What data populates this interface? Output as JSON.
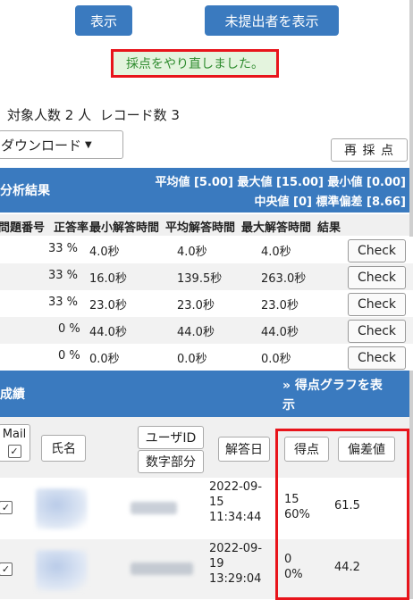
{
  "buttons": {
    "show": "表示",
    "show_unsubmitted": "未提出者を表示",
    "download": "ダウンロード",
    "rescore": "再 採 点"
  },
  "message": "採点をやり直しました。",
  "counts": "対象人数 2 人  レコード数 3",
  "analysis": {
    "title": "分析結果",
    "stats_line1": "平均値 [5.00] 最大値 [15.00] 最小値 [0.00]",
    "stats_line2": "中央値 [0] 標準偏差 [8.66]"
  },
  "question_table": {
    "headers": [
      "問題番号",
      "正答率",
      "最小解答時間",
      "平均解答時間",
      "最大解答時間",
      "結果"
    ],
    "check_label": "Check",
    "rows": [
      {
        "rate": "33 %",
        "min": "4.0秒",
        "avg": "4.0秒",
        "max": "4.0秒"
      },
      {
        "rate": "33 %",
        "min": "16.0秒",
        "avg": "139.5秒",
        "max": "263.0秒"
      },
      {
        "rate": "33 %",
        "min": "23.0秒",
        "avg": "23.0秒",
        "max": "23.0秒"
      },
      {
        "rate": "0 %",
        "min": "44.0秒",
        "avg": "44.0秒",
        "max": "44.0秒"
      },
      {
        "rate": "0 %",
        "min": "0.0秒",
        "avg": "0.0秒",
        "max": "0.0秒"
      }
    ]
  },
  "results": {
    "title": "成績",
    "graph_link": "» 得点グラフを表示",
    "graph_link_line1": "» 得点グラフを表",
    "graph_link_line2": "示",
    "headers": {
      "mail": "Mail",
      "name": "氏名",
      "userid": "ユーザID",
      "digits": "数字部分",
      "date": "解答日",
      "score": "得点",
      "deviation": "偏差値"
    },
    "rows": [
      {
        "date_l1": "2022-09-",
        "date_l2": "15",
        "date_l3": "11:34:44",
        "score": "15",
        "percent": "60%",
        "deviation": "61.5"
      },
      {
        "date_l1": "2022-09-",
        "date_l2": "19",
        "date_l3": "13:29:04",
        "score": "0",
        "percent": "0%",
        "deviation": "44.2"
      }
    ]
  },
  "colors": {
    "accent": "#3a7abf",
    "highlight": "#e8141b",
    "success_text": "#2e8b2e"
  },
  "icons": {
    "caret": "caret-down-icon",
    "check": "checkmark-icon"
  }
}
